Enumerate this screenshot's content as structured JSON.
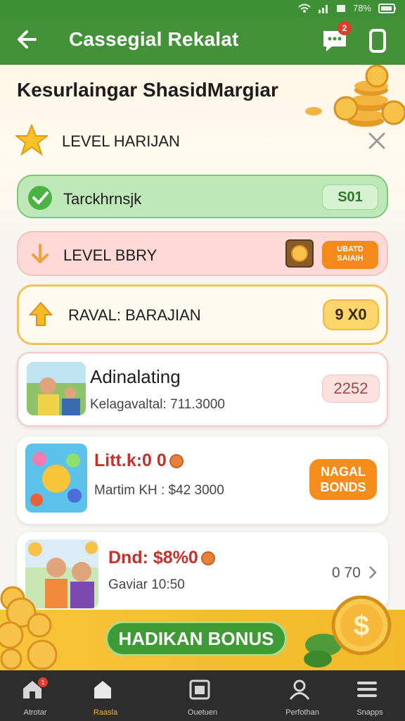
{
  "status": {
    "battery": "78%"
  },
  "appbar": {
    "title": "Cassegial Rekalat",
    "chat_badge": "2"
  },
  "hero": {
    "title": "Kesurlaingar ShasidMargiar"
  },
  "level": {
    "label": "LEVEL HARIJAN"
  },
  "rows": {
    "green": {
      "label": "Tarckhrnsjk",
      "badge": "S01"
    },
    "pink": {
      "label": "LEVEL BBRY",
      "badge_line1": "UBATD",
      "badge_line2": "SAIAIH"
    },
    "yellow": {
      "label": "RAVAL: BARAJIAN",
      "badge": "9 X0"
    }
  },
  "cards": [
    {
      "title": "Adinalating",
      "subtitle": "Kelagavaltal: 711.3000",
      "value": "2252"
    },
    {
      "title": "Litt.k:0 0",
      "subtitle": "Martim KH : $42 3000",
      "cta_line1": "NAGAL",
      "cta_line2": "BONDS"
    },
    {
      "title": "Dnd: $8%0",
      "subtitle": "Gaviar 10:50",
      "value": "0 70"
    }
  ],
  "promo": {
    "button": "HADIKAN BONUS"
  },
  "nav": [
    {
      "label": "Atrotar",
      "icon": "home-icon",
      "badge": "1"
    },
    {
      "label": "Raasla",
      "icon": "house-icon"
    },
    {
      "label": "Ouetuen",
      "icon": "calendar-icon"
    },
    {
      "label": "Perfothan",
      "icon": "profile-icon"
    },
    {
      "label": "Snapps",
      "icon": "menu-icon"
    }
  ],
  "colors": {
    "appbar": "#43923a",
    "accent_orange": "#f48a1b",
    "accent_gold": "#f3b92b"
  }
}
